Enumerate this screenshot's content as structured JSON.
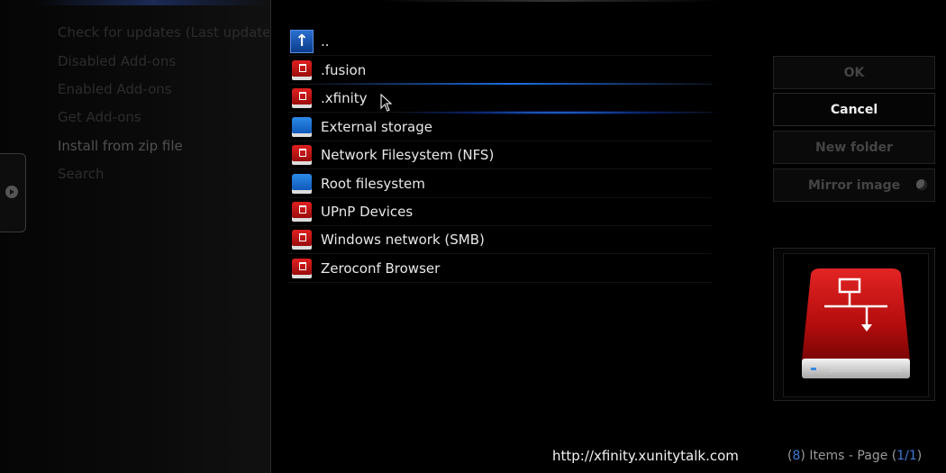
{
  "colors": {
    "accent": "#3e7ad6",
    "drive_red": "#c41212",
    "drive_blue": "#1e6fe0",
    "focus_glow": "#2a86ff"
  },
  "background_menu": {
    "items": [
      {
        "label": "Check for updates (Last updated"
      },
      {
        "label": "Disabled Add-ons"
      },
      {
        "label": "Enabled Add-ons"
      },
      {
        "label": "Get Add-ons"
      },
      {
        "label": "Install from zip file"
      },
      {
        "label": "Search"
      }
    ]
  },
  "file_list": {
    "items": [
      {
        "label": "..",
        "icon": "parent-folder-icon"
      },
      {
        "label": ".fusion",
        "icon": "network-drive-icon"
      },
      {
        "label": ".xfinity",
        "icon": "network-drive-icon"
      },
      {
        "label": "External storage",
        "icon": "local-drive-icon"
      },
      {
        "label": "Network Filesystem (NFS)",
        "icon": "network-drive-icon"
      },
      {
        "label": "Root filesystem",
        "icon": "local-drive-icon"
      },
      {
        "label": "UPnP Devices",
        "icon": "network-drive-icon"
      },
      {
        "label": "Windows network (SMB)",
        "icon": "network-drive-icon"
      },
      {
        "label": "Zeroconf Browser",
        "icon": "network-drive-icon"
      }
    ]
  },
  "buttons": {
    "ok": "OK",
    "cancel": "Cancel",
    "new_folder": "New folder",
    "mirror_image": "Mirror image"
  },
  "thumbnail": {
    "icon": "network-drive-large-icon"
  },
  "status": {
    "url": "http://xfinity.xunitytalk.com",
    "items_count": "8",
    "items_label": "Items - Page",
    "page": "1/1"
  }
}
